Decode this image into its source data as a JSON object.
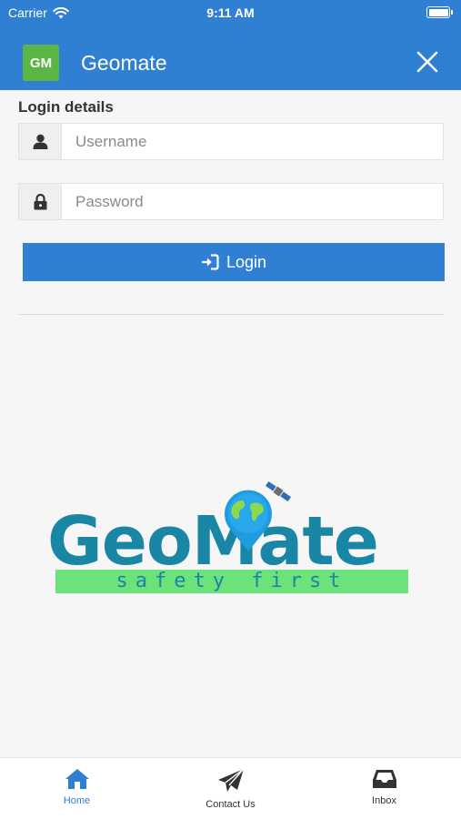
{
  "status_bar": {
    "carrier": "Carrier",
    "time": "9:11 AM"
  },
  "app_bar": {
    "logo_text": "GM",
    "title": "Geomate"
  },
  "login": {
    "section_title": "Login details",
    "username_placeholder": "Username",
    "username_value": "",
    "password_placeholder": "Password",
    "password_value": "",
    "login_label": "Login"
  },
  "brand": {
    "word": "GeoMate",
    "tagline": "safety first"
  },
  "tabs": [
    {
      "label": "Home",
      "icon": "home-icon",
      "active": true
    },
    {
      "label": "Contact Us",
      "icon": "paper-plane-icon",
      "active": false
    },
    {
      "label": "Inbox",
      "icon": "inbox-icon",
      "active": false
    }
  ],
  "colors": {
    "primary": "#2f80d2",
    "logo_green": "#5bb545",
    "brand_teal": "#1a86a6",
    "tagline_green": "#6be27a"
  }
}
